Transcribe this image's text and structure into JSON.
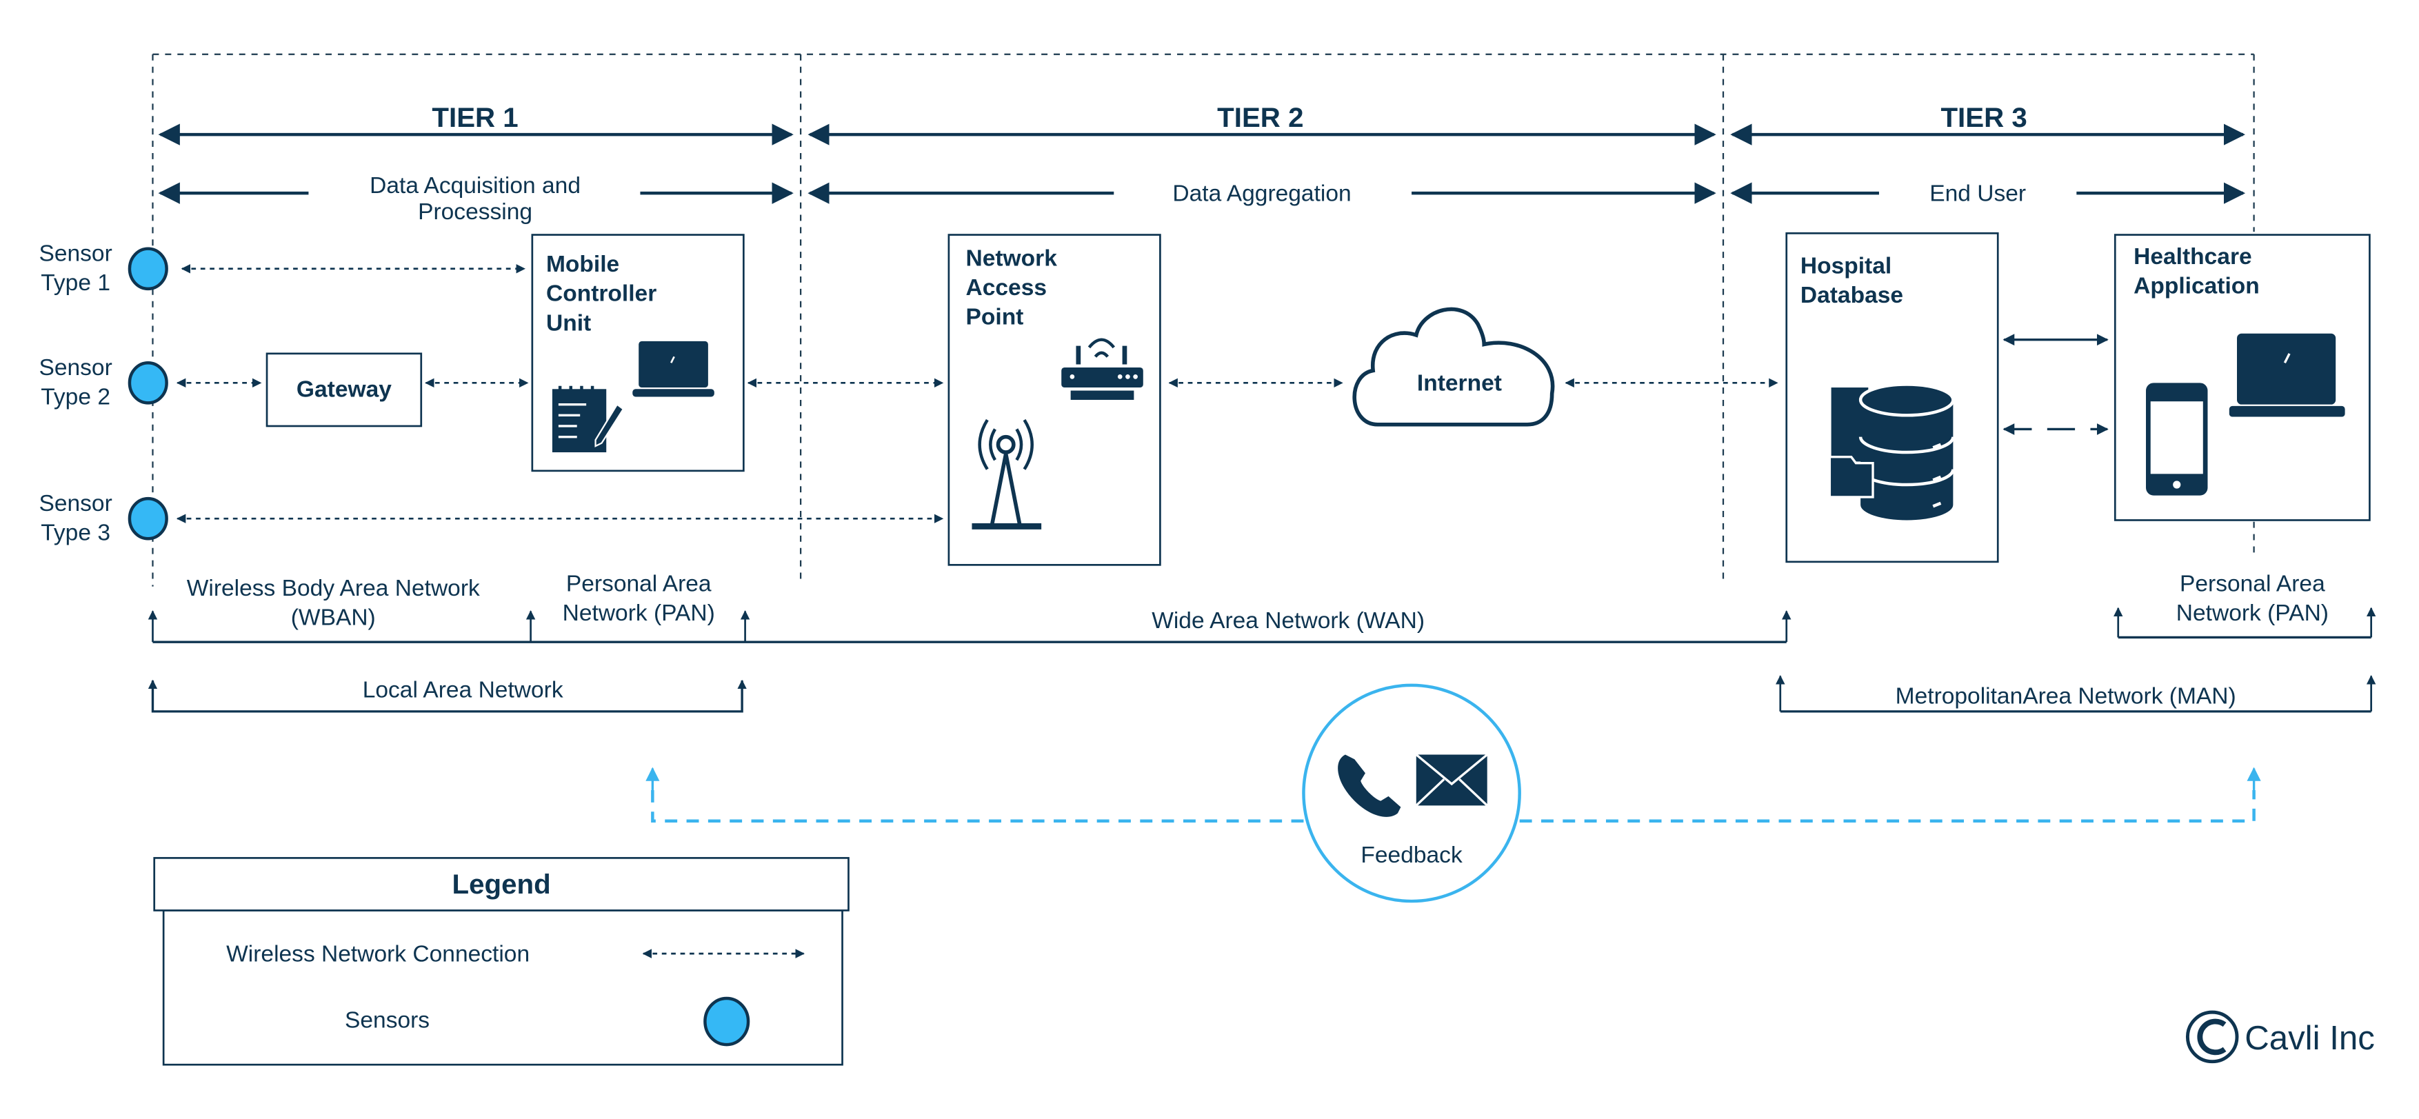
{
  "tiers": [
    {
      "label": "TIER 1",
      "sublabel_line1": "Data Acquisition and",
      "sublabel_line2": "Processing"
    },
    {
      "label": "TIER 2",
      "sublabel": "Data Aggregation"
    },
    {
      "label": "TIER 3",
      "sublabel": "End User"
    }
  ],
  "sensors": [
    {
      "line1": "Sensor",
      "line2": "Type 1"
    },
    {
      "line1": "Sensor",
      "line2": "Type 2"
    },
    {
      "line1": "Sensor",
      "line2": "Type 3"
    }
  ],
  "nodes": {
    "gateway": "Gateway",
    "mobile_controller": [
      "Mobile",
      "Controller",
      "Unit"
    ],
    "network_access_point": [
      "Network",
      "Access",
      "Point"
    ],
    "internet": "Internet",
    "hospital_database": [
      "Hospital",
      "Database"
    ],
    "healthcare_application": [
      "Healthcare",
      "Application"
    ]
  },
  "networks": {
    "wban": [
      "Wireless Body Area Network",
      "(WBAN)"
    ],
    "pan_left": [
      "Personal Area",
      "Network (PAN)"
    ],
    "wan": "Wide Area Network (WAN)",
    "lan": "Local Area Network",
    "pan_right": [
      "Personal Area",
      "Network (PAN)"
    ],
    "man": "MetropolitanArea Network (MAN)"
  },
  "feedback": {
    "label": "Feedback",
    "icons": [
      "phone-icon",
      "envelope-icon"
    ]
  },
  "legend": {
    "title": "Legend",
    "items": [
      {
        "label": "Wireless Network Connection",
        "symbol": "dashed-double-arrow"
      },
      {
        "label": "Sensors",
        "symbol": "blue-circle"
      }
    ]
  },
  "brand": {
    "copyright_symbol": "©",
    "name": "Cavli Inc"
  },
  "colors": {
    "primary": "#0e3450",
    "sensor": "#35b8f5",
    "feedback": "#3ab4ee"
  }
}
